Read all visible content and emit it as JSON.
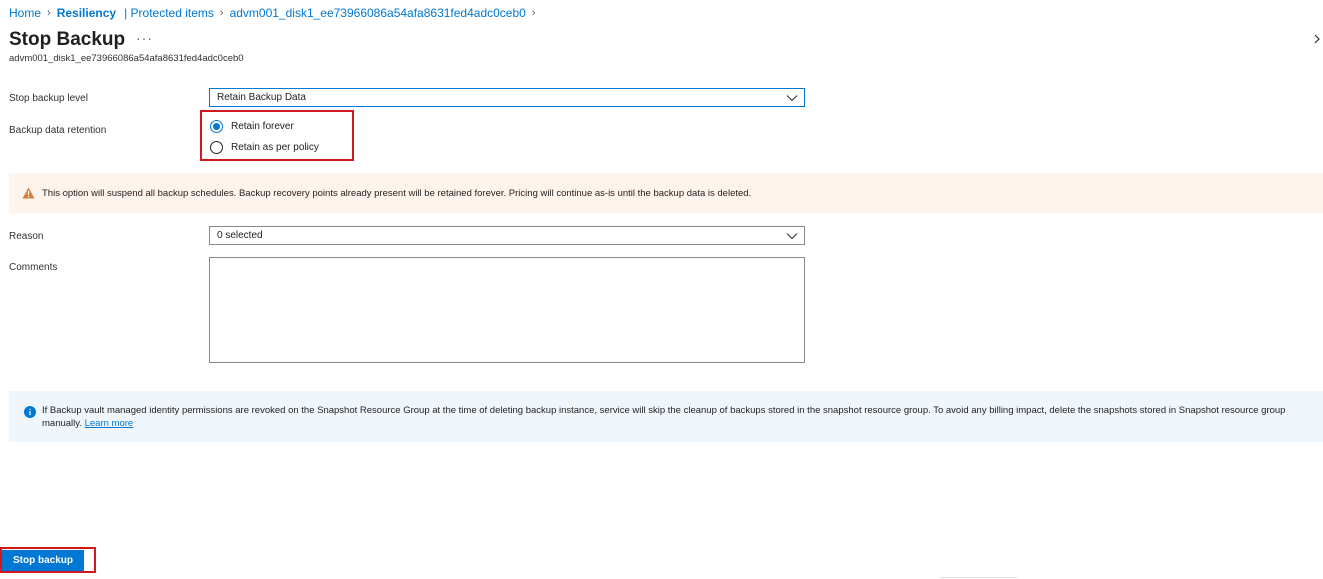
{
  "breadcrumb": {
    "home": "Home",
    "resiliency": "Resiliency",
    "protected_items": "| Protected items",
    "item": "advm001_disk1_ee73966086a54afa8631fed4adc0ceb0"
  },
  "header": {
    "title": "Stop Backup",
    "more": "···",
    "subtitle": "advm001_disk1_ee73966086a54afa8631fed4adc0ceb0"
  },
  "form": {
    "stop_level_label": "Stop backup level",
    "stop_level_value": "Retain Backup Data",
    "retention_label": "Backup data retention",
    "retention_options": [
      {
        "label": "Retain forever",
        "selected": true
      },
      {
        "label": "Retain as per policy",
        "selected": false
      }
    ],
    "reason_label": "Reason",
    "reason_value": "0 selected",
    "comments_label": "Comments",
    "comments_value": ""
  },
  "warning": {
    "icon": "warning-triangle-icon",
    "text": "This option will suspend all backup schedules. Backup recovery points already present will be retained forever. Pricing will continue as-is until the backup data is deleted."
  },
  "info": {
    "icon": "info-circle-icon",
    "text": "If Backup vault managed identity permissions are revoked on the Snapshot Resource Group at the time of deleting backup instance, service will skip the cleanup of backups stored in the snapshot resource group. To avoid any billing impact, delete the snapshots stored in Snapshot resource group manually.",
    "link": "Learn more"
  },
  "actions": {
    "stop_backup": "Stop backup"
  },
  "colors": {
    "accent": "#0078d4",
    "highlight": "#d0191f",
    "warning_bg": "#fff4ec",
    "warning_icon": "#d67f3c",
    "info_bg": "#eff6fc"
  }
}
